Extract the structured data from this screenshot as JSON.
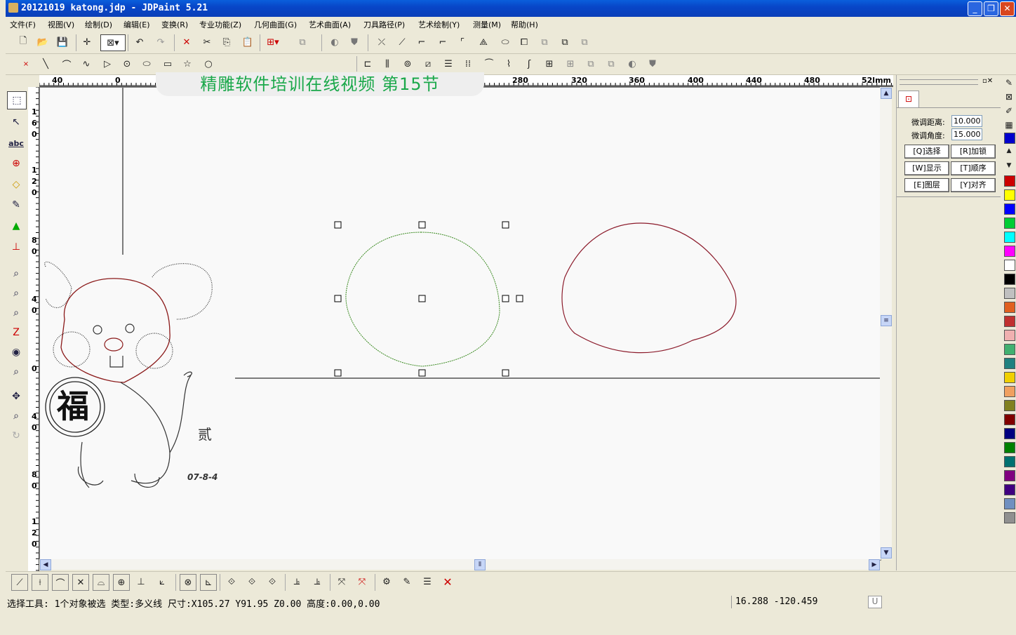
{
  "window": {
    "title": "20121019 katong.jdp - JDPaint 5.21"
  },
  "menu": [
    "文件(F)",
    "视图(V)",
    "绘制(D)",
    "编辑(E)",
    "变换(R)",
    "专业功能(Z)",
    "几何曲面(G)",
    "艺术曲面(A)",
    "刀具路径(P)",
    "艺术绘制(Y)",
    "测量(M)",
    "帮助(H)"
  ],
  "banner": "精雕软件培训在线视频   第15节",
  "hruler": [
    "40",
    "0",
    "280",
    "320",
    "360",
    "400",
    "440",
    "480",
    "52lmm"
  ],
  "vruler": [
    {
      "d": [
        "1",
        "6",
        "0"
      ]
    },
    {
      "d": [
        "1",
        "2",
        "0"
      ]
    },
    {
      "d": [
        "8",
        "0"
      ]
    },
    {
      "d": [
        "4",
        "0"
      ]
    },
    {
      "d": [
        "0"
      ]
    },
    {
      "d": [
        "4",
        "0"
      ]
    },
    {
      "d": [
        "8",
        "0"
      ]
    },
    {
      "d": [
        "1",
        "2",
        "0"
      ]
    }
  ],
  "panel": {
    "dist_label": "微调距离:",
    "dist_value": "10.000",
    "angle_label": "微调角度:",
    "angle_value": "15.000",
    "buttons": [
      "[Q]选择",
      "[R]加锁",
      "[W]显示",
      "[T]顺序",
      "[E]图层",
      "[Y]对齐"
    ]
  },
  "artwork": {
    "fu": "福",
    "sign": "贰",
    "date": "07-8-4"
  },
  "palette": [
    "#cc0000",
    "#ffff00",
    "#0000ff",
    "#00cc33",
    "#00ffff",
    "#ff00ff",
    "#ffffff",
    "#000000",
    "#c0c0c0",
    "#e06020",
    "#c03030",
    "#f0b0b0",
    "#40b070",
    "#208080",
    "#f0d000",
    "#f0a060",
    "#808020",
    "#800000",
    "#000080",
    "#008000",
    "#007070",
    "#800080",
    "#400080",
    "#7090c0",
    "#909090"
  ],
  "status": {
    "text": "选择工具: 1个对象被选 类型:多义线 尺寸:X105.27 Y91.95 Z0.00 高度:0.00,0.00",
    "coords": "16.288 -120.459",
    "mode": "U"
  }
}
